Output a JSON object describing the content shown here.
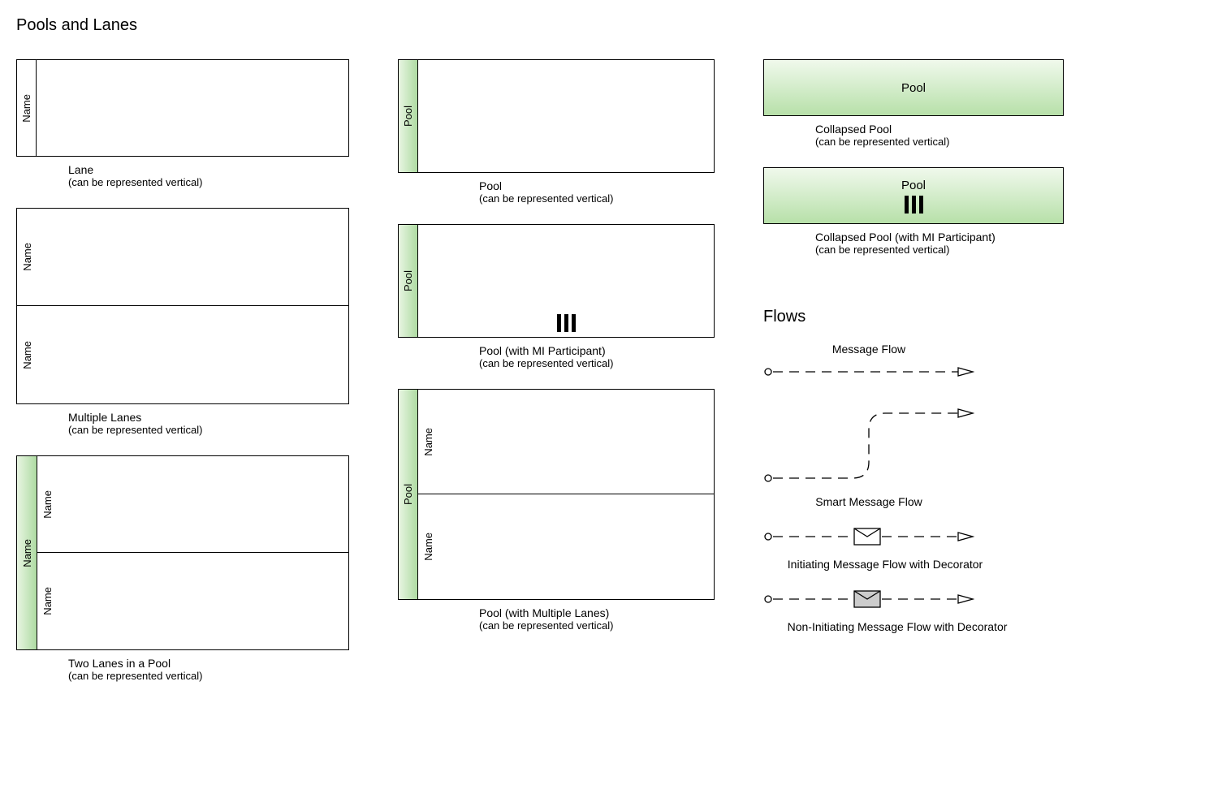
{
  "title": "Pools and Lanes",
  "label_name": "Name",
  "label_pool": "Pool",
  "captions": {
    "lane": {
      "t": "Lane",
      "s": "(can be represented vertical)"
    },
    "multi_lanes": {
      "t": "Multiple Lanes",
      "s": "(can be represented vertical)"
    },
    "two_lanes": {
      "t": "Two Lanes in a Pool",
      "s": "(can be represented vertical)"
    },
    "pool": {
      "t": "Pool",
      "s": "(can be represented vertical)"
    },
    "pool_mi": {
      "t": "Pool (with MI Participant)",
      "s": "(can be represented vertical)"
    },
    "pool_multi": {
      "t": "Pool (with Multiple Lanes)",
      "s": "(can be represented vertical)"
    },
    "collapsed": {
      "t": "Collapsed Pool",
      "s": "(can be represented vertical)"
    },
    "collapsed_mi": {
      "t": "Collapsed Pool (with MI Participant)",
      "s": "(can be represented vertical)"
    }
  },
  "flows": {
    "title": "Flows",
    "message_flow": "Message Flow",
    "smart": "Smart Message Flow",
    "initiating": "Initiating Message Flow with Decorator",
    "non_initiating": "Non-Initiating Message Flow with Decorator"
  }
}
